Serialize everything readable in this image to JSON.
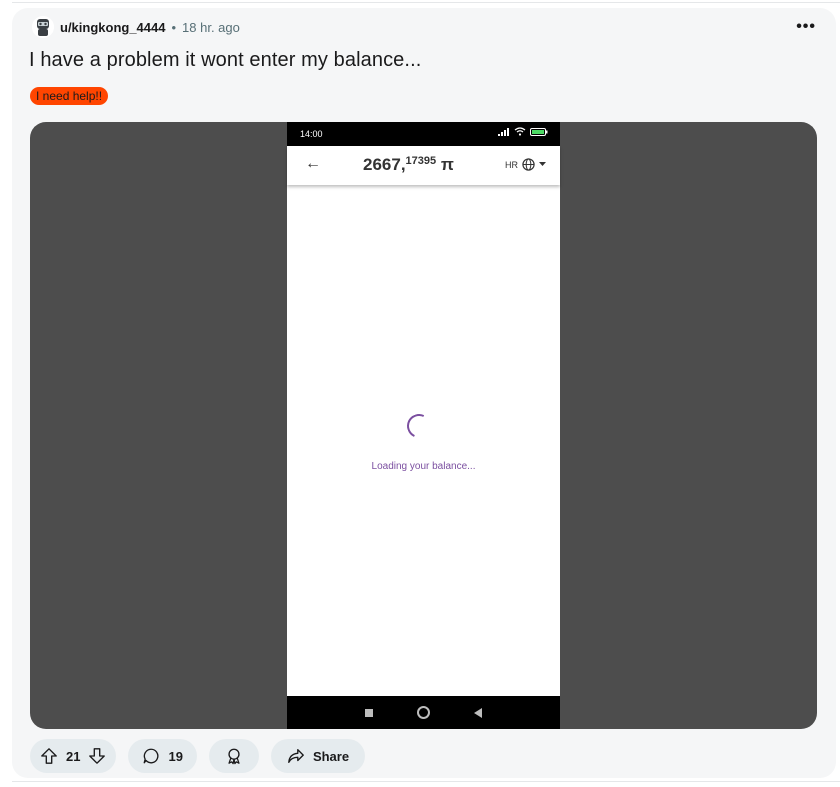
{
  "post": {
    "username": "u/kingkong_4444",
    "separator": "•",
    "time": "18 hr. ago",
    "more_label": "•••",
    "title": "I have a problem it wont enter my balance...",
    "flair": "I need help!!"
  },
  "phone": {
    "status_time": "14:00",
    "balance_int": "2667,",
    "balance_dec": "17395",
    "currency": "π",
    "language": "HR",
    "loading_text": "Loading your balance..."
  },
  "actions": {
    "votes": "21",
    "comments": "19",
    "share_label": "Share"
  },
  "colors": {
    "accent": "#ff4500",
    "spinner": "#7b4fa0"
  }
}
